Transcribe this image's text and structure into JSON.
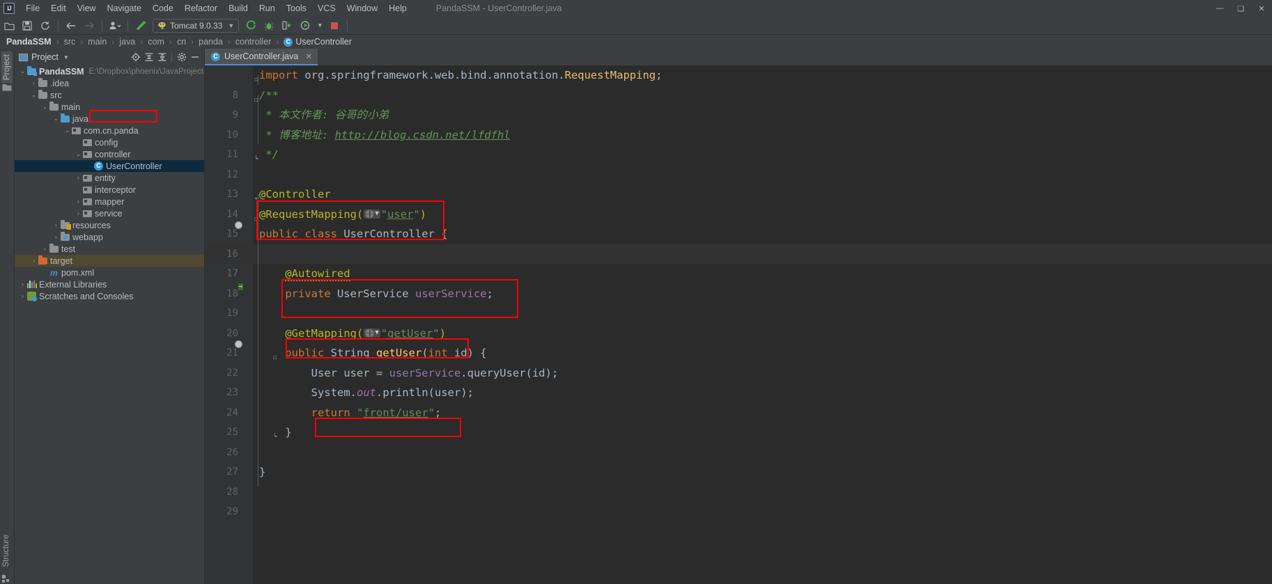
{
  "window": {
    "title": "PandaSSM - UserController.java",
    "logo_text": "IJ",
    "controls": [
      {
        "name": "minimize-button",
        "glyph": "—"
      },
      {
        "name": "maximize-button",
        "glyph": "❑"
      },
      {
        "name": "close-button",
        "glyph": "✕"
      }
    ]
  },
  "menubar": {
    "items": [
      "File",
      "Edit",
      "View",
      "Navigate",
      "Code",
      "Refactor",
      "Build",
      "Run",
      "Tools",
      "VCS",
      "Window",
      "Help"
    ]
  },
  "toolbar": {
    "icons": [
      {
        "name": "open-project-icon",
        "glyph": "🗁"
      },
      {
        "name": "save-all-icon",
        "glyph": "💾"
      },
      {
        "name": "sync-icon",
        "glyph": "↻"
      },
      {
        "name": "back-icon",
        "glyph": "←"
      },
      {
        "name": "forward-icon",
        "glyph": "→"
      },
      {
        "name": "profile-icon",
        "glyph": "👤"
      },
      {
        "name": "build-hammer-icon",
        "glyph": "🔨"
      }
    ],
    "run_config": "Tomcat 9.0.33",
    "run_icons": [
      {
        "name": "run-icon",
        "glyph": "▶"
      },
      {
        "name": "debug-icon",
        "glyph": "🐞"
      },
      {
        "name": "run-with-coverage-icon",
        "glyph": "▶"
      },
      {
        "name": "profiler-icon",
        "glyph": "▶"
      },
      {
        "name": "stop-icon",
        "glyph": "■"
      }
    ]
  },
  "breadcrumb": {
    "items": [
      "PandaSSM",
      "src",
      "main",
      "java",
      "com",
      "cn",
      "panda",
      "controller",
      "UserController"
    ],
    "separator": "›",
    "last_icon": "C"
  },
  "left_strip": {
    "project_tab": "Project",
    "structure_tab": "Structure"
  },
  "project_panel": {
    "title": "Project",
    "header_icons": [
      {
        "name": "locate-file-icon",
        "glyph": "⊕"
      },
      {
        "name": "expand-all-icon",
        "glyph": "≡"
      },
      {
        "name": "collapse-all-icon",
        "glyph": "≡"
      },
      {
        "name": "settings-gear-icon",
        "glyph": "⚙"
      },
      {
        "name": "hide-panel-icon",
        "glyph": "—"
      }
    ],
    "tree": [
      {
        "label": "PandaSSM",
        "sublabel": "E:\\Dropbox\\phoenix\\JavaProjects\\Pa",
        "indent": 0,
        "arrow": "⌄",
        "icon": "project-folder",
        "bold": true
      },
      {
        "label": ".idea",
        "sublabel": "",
        "indent": 1,
        "arrow": "›",
        "icon": "folder"
      },
      {
        "label": "src",
        "sublabel": "",
        "indent": 1,
        "arrow": "⌄",
        "icon": "folder"
      },
      {
        "label": "main",
        "sublabel": "",
        "indent": 2,
        "arrow": "⌄",
        "icon": "folder"
      },
      {
        "label": "java",
        "sublabel": "",
        "indent": 3,
        "arrow": "⌄",
        "icon": "source-folder"
      },
      {
        "label": "com.cn.panda",
        "sublabel": "",
        "indent": 4,
        "arrow": "⌄",
        "icon": "package"
      },
      {
        "label": "config",
        "sublabel": "",
        "indent": 5,
        "arrow": "",
        "icon": "package"
      },
      {
        "label": "controller",
        "sublabel": "",
        "indent": 5,
        "arrow": "⌄",
        "icon": "package"
      },
      {
        "label": "UserController",
        "sublabel": "",
        "indent": 6,
        "arrow": "",
        "icon": "java-class",
        "selected": true,
        "highlighted": true
      },
      {
        "label": "entity",
        "sublabel": "",
        "indent": 5,
        "arrow": "›",
        "icon": "package"
      },
      {
        "label": "interceptor",
        "sublabel": "",
        "indent": 5,
        "arrow": "",
        "icon": "package"
      },
      {
        "label": "mapper",
        "sublabel": "",
        "indent": 5,
        "arrow": "›",
        "icon": "package"
      },
      {
        "label": "service",
        "sublabel": "",
        "indent": 5,
        "arrow": "›",
        "icon": "package"
      },
      {
        "label": "resources",
        "sublabel": "",
        "indent": 3,
        "arrow": "›",
        "icon": "resources-folder"
      },
      {
        "label": "webapp",
        "sublabel": "",
        "indent": 3,
        "arrow": "›",
        "icon": "web-folder"
      },
      {
        "label": "test",
        "sublabel": "",
        "indent": 2,
        "arrow": "›",
        "icon": "folder"
      },
      {
        "label": "target",
        "sublabel": "",
        "indent": 1,
        "arrow": "›",
        "icon": "excluded-folder",
        "row_highlight": true
      },
      {
        "label": "pom.xml",
        "sublabel": "",
        "indent": 2,
        "arrow": "",
        "icon": "maven-file"
      },
      {
        "label": "External Libraries",
        "sublabel": "",
        "indent": 0,
        "arrow": "›",
        "icon": "libraries"
      },
      {
        "label": "Scratches and Consoles",
        "sublabel": "",
        "indent": 0,
        "arrow": "›",
        "icon": "scratches"
      }
    ]
  },
  "editor": {
    "tab": {
      "label": "UserController.java",
      "icon": "C",
      "close": "✕"
    },
    "first_line_number": 8,
    "lines": [
      {
        "n": 8,
        "text": "import org.springframework.web.bind.annotation.RequestMapping;"
      },
      {
        "n": 9,
        "text": "/**"
      },
      {
        "n": 10,
        "text": " * 本文作者: 谷哥的小弟"
      },
      {
        "n": 11,
        "text": " * 博客地址: http://blog.csdn.net/lfdfhl"
      },
      {
        "n": 12,
        "text": " */"
      },
      {
        "n": 13,
        "text": ""
      },
      {
        "n": 14,
        "text": "@Controller"
      },
      {
        "n": 15,
        "text": "@RequestMapping(\"user\")"
      },
      {
        "n": 16,
        "text": "public class UserController {"
      },
      {
        "n": 17,
        "text": ""
      },
      {
        "n": 18,
        "text": "    @Autowired"
      },
      {
        "n": 19,
        "text": "    private UserService userService;"
      },
      {
        "n": 20,
        "text": ""
      },
      {
        "n": 21,
        "text": "    @GetMapping(\"getUser\")"
      },
      {
        "n": 22,
        "text": "    public String getUser(int id) {"
      },
      {
        "n": 23,
        "text": "        User user = userService.queryUser(id);"
      },
      {
        "n": 24,
        "text": "        System.out.println(user);"
      },
      {
        "n": 25,
        "text": "        return \"front/user\";"
      },
      {
        "n": 26,
        "text": "    }"
      },
      {
        "n": 27,
        "text": ""
      },
      {
        "n": 28,
        "text": "}"
      },
      {
        "n": 29,
        "text": ""
      }
    ],
    "inlay_hints": [
      {
        "line": 15,
        "icon": "web-globe-icon",
        "chevron": "⌄"
      },
      {
        "line": 21,
        "icon": "web-globe-icon",
        "chevron": "⌄"
      }
    ],
    "caret_line": 17
  },
  "annotations": {
    "highlight_color": "#fe0000",
    "boxes": [
      {
        "name": "highlight-usercontroller-tree",
        "target": "UserController tree node"
      },
      {
        "name": "highlight-controller-annotations",
        "target": "@Controller @RequestMapping(\"user\")"
      },
      {
        "name": "highlight-autowired-service",
        "target": "@Autowired private UserService userService;"
      },
      {
        "name": "highlight-getmapping",
        "target": "@GetMapping(\"getUser\")"
      },
      {
        "name": "highlight-return-view",
        "target": "return \"front/user\";"
      }
    ]
  }
}
